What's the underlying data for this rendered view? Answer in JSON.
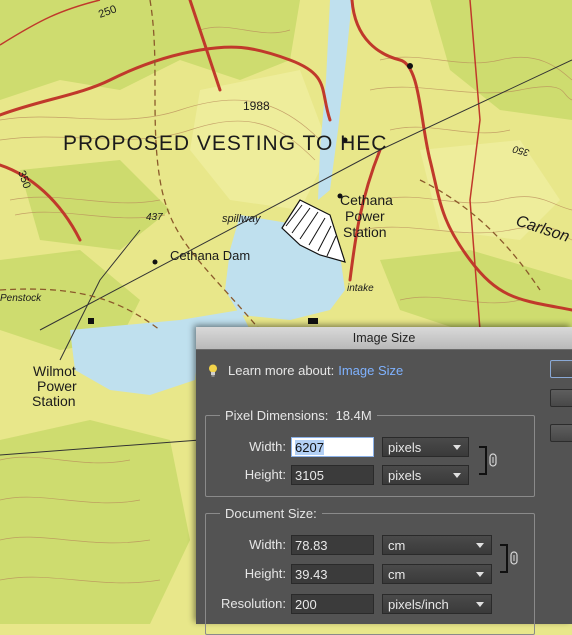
{
  "map": {
    "labels": {
      "proposed_vesting": "PROPOSED   VESTING   TO   HEC",
      "elev_1988": "1988",
      "cethana": "Cethana",
      "power": "Power",
      "station": "Station",
      "spillway": "spillway",
      "cethana_dam": "Cethana Dam",
      "elev_437": "437",
      "penstock": "Penstock",
      "intake": "intake",
      "wilmot": "Wilmot",
      "wilmot_power": "Power",
      "wilmot_station": "Station",
      "carlson": "Carlson",
      "elev_350_left": "350",
      "elev_350_right": "350",
      "elev_250": "250"
    },
    "colors": {
      "land": "#e8e78a",
      "forest": "#c9d96a",
      "water": "#bfe0ee",
      "road": "#c0392b"
    }
  },
  "dialog": {
    "title": "Image Size",
    "learn_more_prefix": "Learn more about:",
    "learn_more_link": "Image Size",
    "pixel_dimensions": {
      "title": "Pixel Dimensions:",
      "size": "18.4M",
      "width_label": "Width:",
      "width_value": "6207",
      "width_unit": "pixels",
      "height_label": "Height:",
      "height_value": "3105",
      "height_unit": "pixels"
    },
    "document_size": {
      "title": "Document Size:",
      "width_label": "Width:",
      "width_value": "78.83",
      "width_unit": "cm",
      "height_label": "Height:",
      "height_value": "39.43",
      "height_unit": "cm",
      "resolution_label": "Resolution:",
      "resolution_value": "200",
      "resolution_unit": "pixels/inch"
    }
  }
}
